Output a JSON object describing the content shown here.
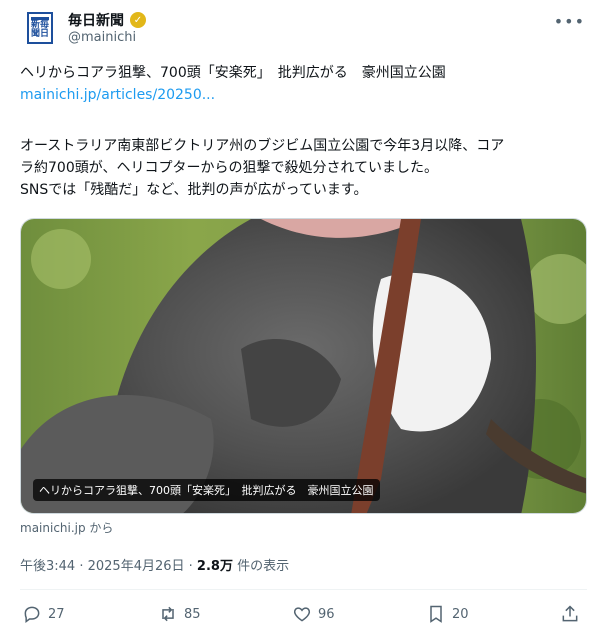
{
  "header": {
    "display_name": "毎日新聞",
    "handle": "@mainichi",
    "logo_text": "新毎聞日",
    "more_icon": "•••"
  },
  "tweet": {
    "headline": "ヘリからコアラ狙撃、700頭「安楽死」　批判広がる　豪州国立公園",
    "link": "mainichi.jp/articles/20250...",
    "body_line1": "オーストラリア南東部ビクトリア州のブジビム国立公園で今年3月以降、コア",
    "body_line2": "ラ約700頭が、ヘリコプターからの狙撃で殺処分されていました。",
    "body_line3": "SNSでは「残酷だ」など、批判の声が広がっています。"
  },
  "card": {
    "caption": "ヘリからコアラ狙撃、700頭「安楽死」　批判広がる　豪州国立公園",
    "source": "mainichi.jp から"
  },
  "meta": {
    "time": "午後3:44",
    "date": "2025年4月26日",
    "views": "2.8万",
    "views_label": "件の表示"
  },
  "actions": {
    "replies": "27",
    "reposts": "85",
    "likes": "96",
    "bookmarks": "20"
  },
  "colors": {
    "link": "#1d9bf0",
    "secondary": "#536471",
    "brand": "#1d4f9c"
  }
}
